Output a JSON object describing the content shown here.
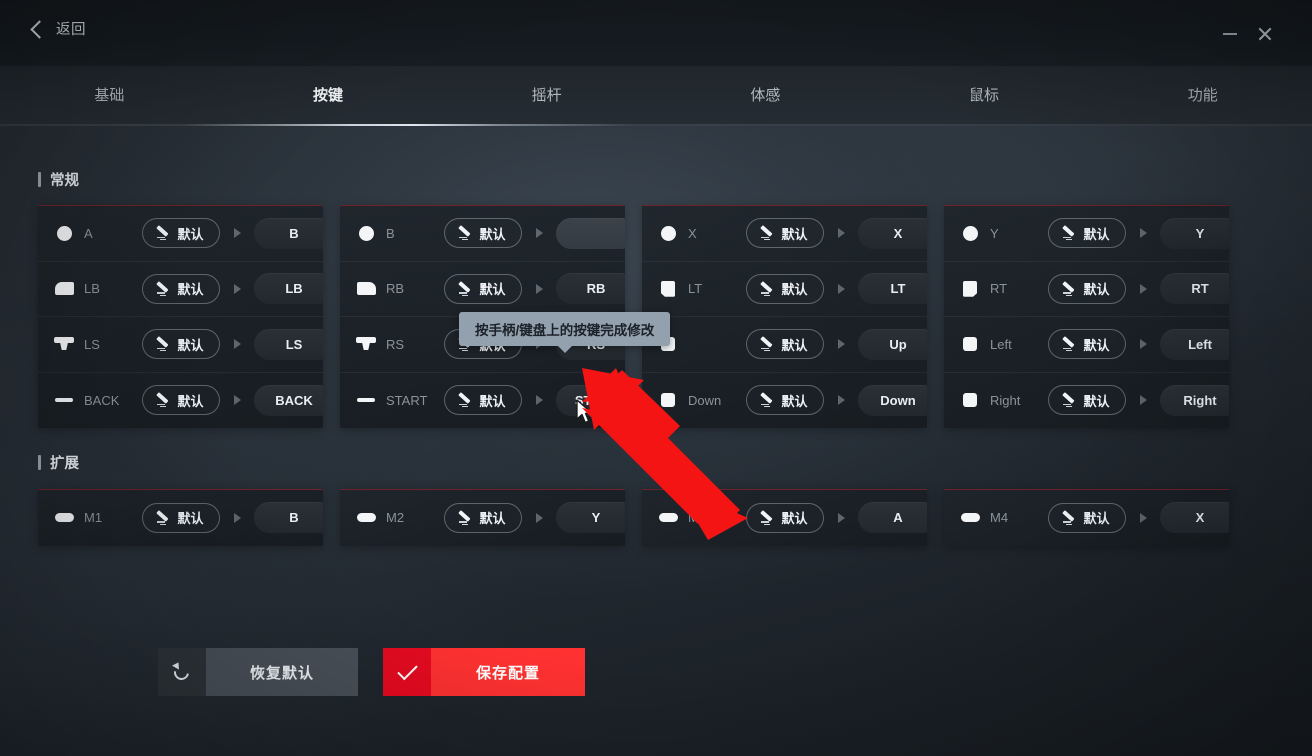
{
  "window": {
    "back_label": "返回",
    "back_icon": "chevron-left-icon",
    "minimize_icon": "minimize-icon",
    "close_icon": "close-icon"
  },
  "tabs": [
    {
      "label": "基础",
      "active": false
    },
    {
      "label": "按键",
      "active": true
    },
    {
      "label": "摇杆",
      "active": false
    },
    {
      "label": "体感",
      "active": false
    },
    {
      "label": "鼠标",
      "active": false
    },
    {
      "label": "功能",
      "active": false
    }
  ],
  "tooltip": {
    "text": "按手柄/键盘上的按键完成修改"
  },
  "sections": [
    {
      "title": "常规",
      "columns": [
        {
          "rows": [
            {
              "icon": "face-button-icon",
              "label": "A",
              "mode_label": "默认",
              "mode_icon": "pencil-icon",
              "value": "B",
              "editing": false
            },
            {
              "icon": "left-bumper-icon",
              "label": "LB",
              "mode_label": "默认",
              "mode_icon": "pencil-icon",
              "value": "LB",
              "editing": false
            },
            {
              "icon": "left-stick-icon",
              "label": "LS",
              "mode_label": "默认",
              "mode_icon": "pencil-icon",
              "value": "LS",
              "editing": false
            },
            {
              "icon": "back-button-icon",
              "label": "BACK",
              "mode_label": "默认",
              "mode_icon": "pencil-icon",
              "value": "BACK",
              "editing": false
            }
          ]
        },
        {
          "rows": [
            {
              "icon": "face-button-icon",
              "label": "B",
              "mode_label": "默认",
              "mode_icon": "pencil-icon",
              "value": "",
              "editing": true
            },
            {
              "icon": "right-bumper-icon",
              "label": "RB",
              "mode_label": "默认",
              "mode_icon": "pencil-icon",
              "value": "RB",
              "editing": false
            },
            {
              "icon": "right-stick-icon",
              "label": "RS",
              "mode_label": "默认",
              "mode_icon": "pencil-icon",
              "value": "RS",
              "editing": false
            },
            {
              "icon": "start-button-icon",
              "label": "START",
              "mode_label": "默认",
              "mode_icon": "pencil-icon",
              "value": "START",
              "editing": false
            }
          ]
        },
        {
          "rows": [
            {
              "icon": "face-button-icon",
              "label": "X",
              "mode_label": "默认",
              "mode_icon": "pencil-icon",
              "value": "X",
              "editing": false
            },
            {
              "icon": "left-trigger-icon",
              "label": "LT",
              "mode_label": "默认",
              "mode_icon": "pencil-icon",
              "value": "LT",
              "editing": false
            },
            {
              "icon": "dpad-up-icon",
              "label": "",
              "mode_label": "默认",
              "mode_icon": "pencil-icon",
              "value": "Up",
              "editing": false
            },
            {
              "icon": "dpad-down-icon",
              "label": "Down",
              "mode_label": "默认",
              "mode_icon": "pencil-icon",
              "value": "Down",
              "editing": false
            }
          ]
        },
        {
          "rows": [
            {
              "icon": "face-button-icon",
              "label": "Y",
              "mode_label": "默认",
              "mode_icon": "pencil-icon",
              "value": "Y",
              "editing": false
            },
            {
              "icon": "right-trigger-icon",
              "label": "RT",
              "mode_label": "默认",
              "mode_icon": "pencil-icon",
              "value": "RT",
              "editing": false
            },
            {
              "icon": "dpad-left-icon",
              "label": "Left",
              "mode_label": "默认",
              "mode_icon": "pencil-icon",
              "value": "Left",
              "editing": false
            },
            {
              "icon": "dpad-right-icon",
              "label": "Right",
              "mode_label": "默认",
              "mode_icon": "pencil-icon",
              "value": "Right",
              "editing": false
            }
          ]
        }
      ]
    },
    {
      "title": "扩展",
      "columns": [
        {
          "rows": [
            {
              "icon": "macro-button-icon",
              "label": "M1",
              "mode_label": "默认",
              "mode_icon": "pencil-icon",
              "value": "B",
              "editing": false
            }
          ]
        },
        {
          "rows": [
            {
              "icon": "macro-button-icon",
              "label": "M2",
              "mode_label": "默认",
              "mode_icon": "pencil-icon",
              "value": "Y",
              "editing": false
            }
          ]
        },
        {
          "rows": [
            {
              "icon": "macro-button-icon",
              "label": "M3",
              "mode_label": "默认",
              "mode_icon": "pencil-icon",
              "value": "A",
              "editing": false
            }
          ]
        },
        {
          "rows": [
            {
              "icon": "macro-button-icon",
              "label": "M4",
              "mode_label": "默认",
              "mode_icon": "pencil-icon",
              "value": "X",
              "editing": false
            }
          ]
        }
      ]
    }
  ],
  "footer": {
    "restore_label": "恢复默认",
    "restore_icon": "undo-icon",
    "save_label": "保存配置",
    "save_icon": "check-icon"
  },
  "colors": {
    "accent_red": "#ff3131",
    "accent_red_dark": "#e60a20",
    "card_top_border": "#6e2229",
    "background": "#232a31",
    "tooltip_bg": "#93a0ad"
  }
}
